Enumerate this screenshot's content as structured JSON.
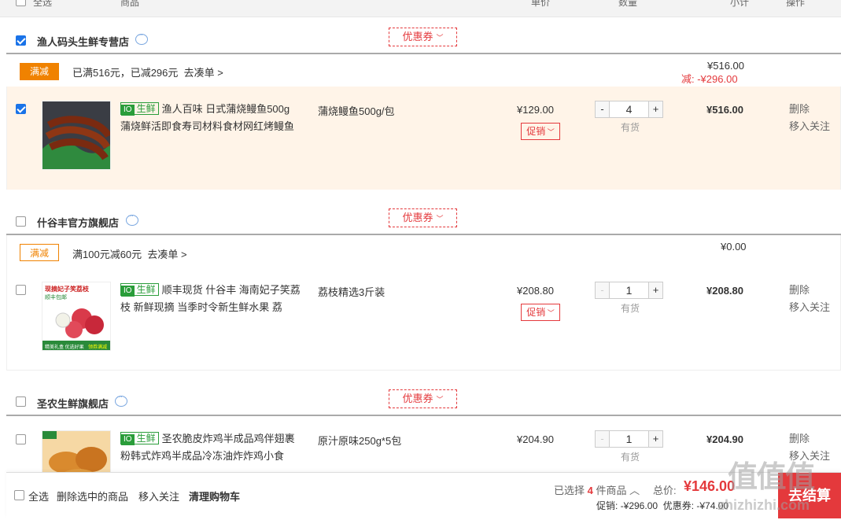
{
  "header": {
    "select_all": "全选",
    "product": "商品",
    "unit_price": "单价",
    "quantity": "数量",
    "subtotal": "小计",
    "operation": "操作"
  },
  "shops": [
    {
      "name": "渔人码头生鲜专营店",
      "coupon": "优惠券",
      "promo_tag": "满减",
      "promo_text": "已满516元，已减296元",
      "promo_link": "去凑单 >",
      "summary_total": "¥516.00",
      "summary_discount": "减: -¥296.00",
      "item": {
        "badge": "生鲜",
        "title": "渔人百味 日式蒲烧鳗鱼500g 蒲烧鲜活即食寿司材料食材网红烤鳗鱼",
        "spec": "蒲烧鳗鱼500g/包",
        "price": "¥129.00",
        "promo": "促销",
        "qty_minus": "-",
        "qty": "4",
        "qty_plus": "+",
        "stock": "有货",
        "subtotal": "¥516.00",
        "delete": "删除",
        "follow": "移入关注"
      }
    },
    {
      "name": "什谷丰官方旗舰店",
      "coupon": "优惠券",
      "promo_tag": "满减",
      "promo_text": "满100元减60元",
      "promo_link": "去凑单 >",
      "summary_total": "¥0.00",
      "item": {
        "badge": "生鲜",
        "title": "顺丰现货 什谷丰 海南妃子笑荔枝 新鲜现摘 当季时令新生鲜水果 荔",
        "spec": "荔枝精选3斤装",
        "price": "¥208.80",
        "promo": "促销",
        "qty_minus": "-",
        "qty": "1",
        "qty_plus": "+",
        "stock": "有货",
        "subtotal": "¥208.80",
        "delete": "删除",
        "follow": "移入关注"
      }
    },
    {
      "name": "圣农生鲜旗舰店",
      "coupon": "优惠券",
      "item": {
        "badge": "生鲜",
        "title": "圣农脆皮炸鸡半成品鸡伴翅裹粉韩式炸鸡半成品冷冻油炸炸鸡小食",
        "spec": "原汁原味250g*5包",
        "price": "¥204.90",
        "qty_minus": "-",
        "qty": "1",
        "qty_plus": "+",
        "stock": "有货",
        "subtotal": "¥204.90",
        "delete": "删除",
        "follow": "移入关注"
      }
    }
  ],
  "product_image_text": {
    "lychee_top": "现摘妃子笑荔枝",
    "lychee_sub": "顺丰包邮",
    "lychee_bottom1": "精美礼盒 优选好果",
    "lychee_bottom2": "领券满减"
  },
  "footer": {
    "select_all": "全选",
    "delete_selected": "删除选中的商品",
    "move_follow": "移入关注",
    "clear_cart": "清理购物车",
    "selected_prefix": "已选择",
    "selected_count": "4",
    "selected_suffix": "件商品",
    "total_label": "总价:",
    "total_value": "¥146.00",
    "promo_line": "促销: -¥296.00  优惠券: -¥74.00",
    "checkout": "去结算"
  },
  "watermark": {
    "main": "值 值 值",
    "url": "zhizhizhi.com"
  }
}
